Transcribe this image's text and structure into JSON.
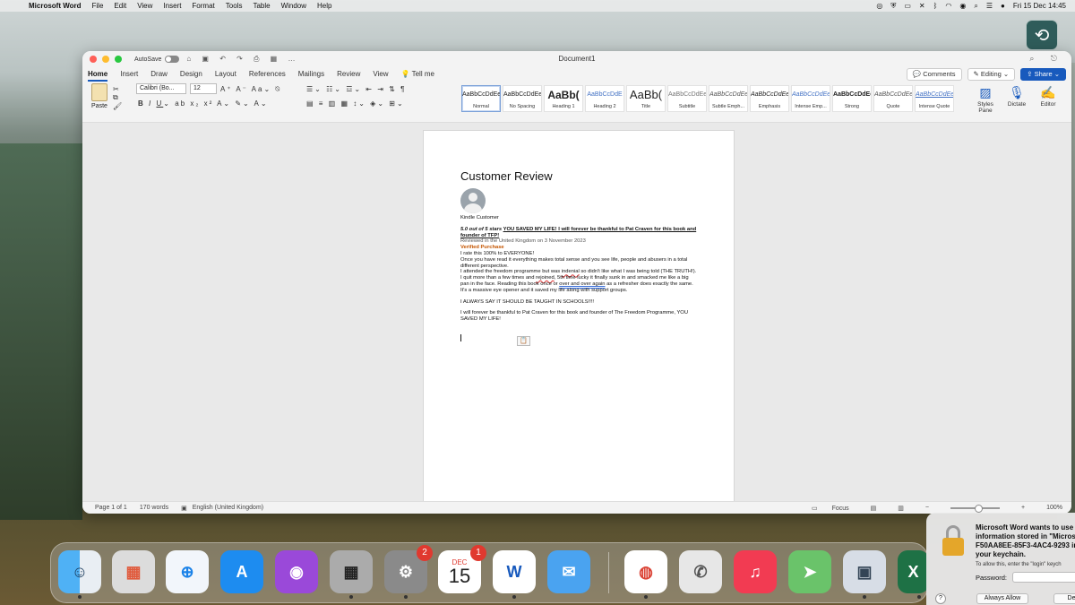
{
  "menubar": {
    "app_name": "Microsoft Word",
    "items": [
      "File",
      "Edit",
      "View",
      "Insert",
      "Format",
      "Tools",
      "Table",
      "Window",
      "Help"
    ],
    "clock": "Fri 15 Dec  14:45"
  },
  "window": {
    "autosave_label": "AutoSave",
    "doc_title": "Document1",
    "tabs": [
      "Home",
      "Insert",
      "Draw",
      "Design",
      "Layout",
      "References",
      "Mailings",
      "Review",
      "View"
    ],
    "tell_me": "Tell me",
    "comments_label": "Comments",
    "editing_label": "Editing",
    "share_label": "Share"
  },
  "ribbon": {
    "paste_label": "Paste",
    "font_name": "Calibri (Bo...",
    "font_size": "12",
    "styles": [
      {
        "preview": "AaBbCcDdEe",
        "name": "Normal"
      },
      {
        "preview": "AaBbCcDdEe",
        "name": "No Spacing"
      },
      {
        "preview": "AaBb(",
        "name": "Heading 1"
      },
      {
        "preview": "AaBbCcDdE",
        "name": "Heading 2"
      },
      {
        "preview": "AaBb(",
        "name": "Title"
      },
      {
        "preview": "AaBbCcDdEe",
        "name": "Subtitle"
      },
      {
        "preview": "AaBbCcDdEe",
        "name": "Subtle Emph..."
      },
      {
        "preview": "AaBbCcDdEe",
        "name": "Emphasis"
      },
      {
        "preview": "AaBbCcDdEe",
        "name": "Intense Emp..."
      },
      {
        "preview": "AaBbCcDdEe",
        "name": "Strong"
      },
      {
        "preview": "AaBbCcDdEe",
        "name": "Quote"
      },
      {
        "preview": "AaBbCcDdEe",
        "name": "Intense Quote"
      }
    ],
    "styles_pane_label": "Styles Pane",
    "dictate_label": "Dictate",
    "editor_label": "Editor"
  },
  "document": {
    "heading": "Customer Review",
    "reviewer": "Kindle Customer",
    "rating": "5.0 out of 5 stars",
    "review_title": "YOU SAVED MY LIFE! I will forever be thankful to Pat Craven for this book and founder of TFP!",
    "reviewed_in": "Reviewed in the United Kingdom on 3 November 2023",
    "verified": "Verified Purchase",
    "line1": "I rate this 100% to EVERYONE!",
    "line2": "Once you have read it everything makes total sense and you see life, people and abusers in a total different perspective.",
    "line3a": "I attended the freedom programme but was ",
    "line3_err": "indenial",
    "line3b": " so didn't like what I was being told (THE TRUTH!).",
    "line4a": "I quit more than a few times and ",
    "line4_err": "rejoined",
    "line4b": ", 5th time lucky it finally sunk in and smacked me like a big pan in the face. Reading this book once or ",
    "line4_err2": "over and over again",
    "line4c": " as a refresher does exactly the same. It's a massive eye opener and it saved my life along with support groups.",
    "line5": "I ALWAYS SAY IT SHOULD BE TAUGHT IN SCHOOLS!!!!",
    "line6": "I will forever be thankful to Pat Craven for this book and founder of The Freedom Programme, YOU SAVED MY LIFE!"
  },
  "status": {
    "page": "Page 1 of 1",
    "words": "170 words",
    "language": "English (United Kingdom)",
    "focus": "Focus",
    "zoom": "100%"
  },
  "dock": {
    "calendar_month": "DEC",
    "calendar_day": "15",
    "settings_badge": "2",
    "calendar_badge": "1"
  },
  "keychain": {
    "title": "Microsoft Word wants to use information stored in \"Micros F50AA8EE-85F3-4AC4-9293 in your keychain.",
    "subtitle": "To allow this, enter the \"login\" keych",
    "password_label": "Password:",
    "allow_label": "Always Allow",
    "deny_label": "De"
  }
}
